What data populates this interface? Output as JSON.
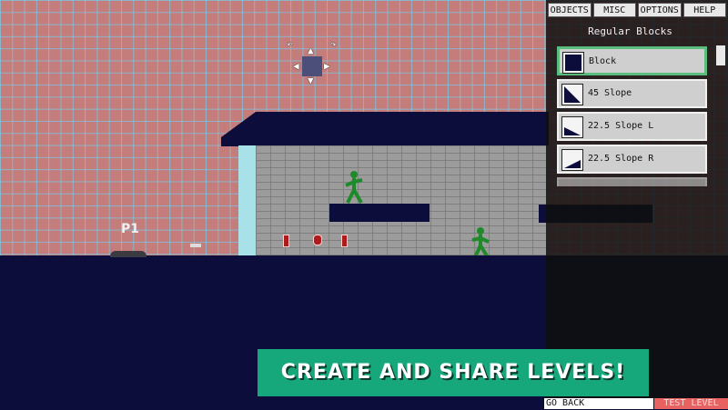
{
  "tabs": [
    "OBJECTS",
    "MISC",
    "OPTIONS",
    "HELP"
  ],
  "panel": {
    "title": "Regular Blocks",
    "items": [
      {
        "label": "Block",
        "icon": "solid-block-icon",
        "selected": true
      },
      {
        "label": "45 Slope",
        "icon": "slope-45-icon",
        "selected": false
      },
      {
        "label": "22.5 Slope L",
        "icon": "slope-22-left-icon",
        "selected": false
      },
      {
        "label": "22.5 Slope R",
        "icon": "slope-22-right-icon",
        "selected": false
      }
    ]
  },
  "level": {
    "player_label": "P1"
  },
  "banner": {
    "text": "CREATE AND SHARE LEVELS!"
  },
  "footer": {
    "go_back": "GO BACK",
    "test_level": "TEST LEVEL"
  },
  "colors": {
    "navy": "#0c0d3a",
    "enemy_green": "#1e8a2a",
    "banner_green": "#16a77a",
    "selected_border": "#5bbd7d",
    "test_level_red": "#e86262"
  }
}
